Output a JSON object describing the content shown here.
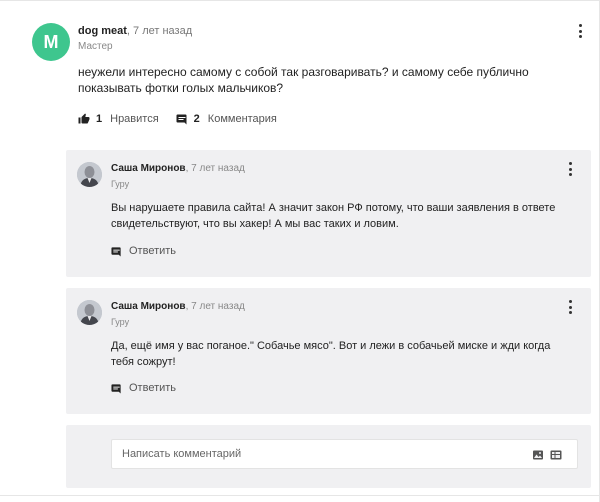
{
  "comment": {
    "avatar_letter": "M",
    "author": "dog meat",
    "time": "7 лет назад",
    "rank": "Мастер",
    "text": "неужели интересно самому с собой так разговаривать? и самому себе публично показывать фотки голых мальчиков?",
    "likes": "1",
    "like_label": "Нравится",
    "comments_count": "2",
    "comments_label": "Комментария"
  },
  "replies": [
    {
      "author": "Саша Миронов",
      "time": "7 лет назад",
      "rank": "Гуру",
      "text": "Вы нарушаете правила сайта! А значит закон РФ потому, что ваши заявления в ответе свидетельствуют, что вы хакер! А мы вас таких и ловим.",
      "reply_label": "Ответить"
    },
    {
      "author": "Саша Миронов",
      "time": "7 лет назад",
      "rank": "Гуру",
      "text": "Да, ещё имя у вас поганое.\" Собачье мясо\". Вот и лежи в собачьей миске и жди когда тебя сожрут!",
      "reply_label": "Ответить"
    }
  ],
  "composer": {
    "placeholder": "Написать комментарий"
  },
  "colors": {
    "avatar_bg": "#3ec68e",
    "card_bg": "#f0f0f2"
  },
  "icons": [
    "thumbs-up-icon",
    "comment-icon",
    "more-vertical-icon",
    "image-icon",
    "gif-icon"
  ]
}
